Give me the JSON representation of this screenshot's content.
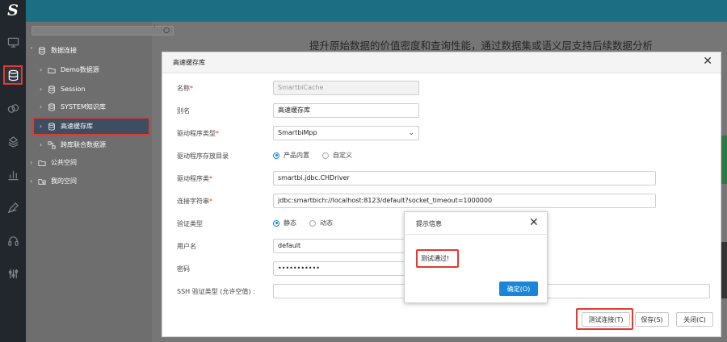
{
  "headline": "提升原始数据的价值密度和查询性能，通过数据集或语义层支持后续数据分析",
  "nav": {
    "logo": "S",
    "items": [
      {
        "name": "monitor-icon"
      },
      {
        "name": "database-icon",
        "active": true
      },
      {
        "name": "cubes-icon"
      },
      {
        "name": "layers-icon"
      },
      {
        "name": "bar-chart-icon"
      },
      {
        "name": "pen-icon"
      },
      {
        "name": "headset-icon"
      },
      {
        "name": "tools-icon"
      }
    ]
  },
  "tree": {
    "search_placeholder": "",
    "items": [
      {
        "label": "数据连接",
        "icon": "database-icon",
        "expanded": true
      },
      {
        "label": "Demo数据源",
        "icon": "folder-icon"
      },
      {
        "label": "Session",
        "icon": "database-icon"
      },
      {
        "label": "SYSTEM知识库",
        "icon": "database-icon"
      },
      {
        "label": "高速缓存库",
        "icon": "database-icon",
        "selected": true
      },
      {
        "label": "跨库联合数据源",
        "icon": "link-icon"
      },
      {
        "label": "公共空间",
        "icon": "folder-icon"
      },
      {
        "label": "我的空间",
        "icon": "user-folder-icon"
      }
    ]
  },
  "dialog": {
    "title": "高速缓存库",
    "fields": {
      "name": {
        "label": "名称",
        "value": "SmartbiCache"
      },
      "alias": {
        "label": "别名",
        "value": "高速缓存库"
      },
      "driver_type": {
        "label": "驱动程序类型",
        "value": "SmartbiMpp"
      },
      "driver_dir": {
        "label": "驱动程序存放目录",
        "options": [
          "产品内置",
          "自定义"
        ],
        "selected": "产品内置"
      },
      "driver_class": {
        "label": "驱动程序类",
        "value": "smartbi.jdbc.CHDriver"
      },
      "conn_string": {
        "label": "连接字符串",
        "value": "jdbc:smartbich://localhost:8123/default?socket_timeout=1000000"
      },
      "auth_type": {
        "label": "验证类型",
        "options": [
          "静态",
          "动态"
        ],
        "selected": "静态"
      },
      "username": {
        "label": "用户名",
        "value": "default"
      },
      "password": {
        "label": "密码",
        "value": "•••••••••••"
      },
      "ssh": {
        "label": "SSH 验证类型 (允许空值) :",
        "value": ""
      }
    },
    "buttons": {
      "test": "测试连接(T)",
      "save": "保存(S)",
      "close": "关闭(C)"
    }
  },
  "popup": {
    "title": "提示信息",
    "message": "测试通过!",
    "ok": "确定(O)"
  },
  "colors": {
    "accent": "#1a86d8",
    "highlight": "#e23a2f",
    "topbar": "#1c6f83"
  }
}
